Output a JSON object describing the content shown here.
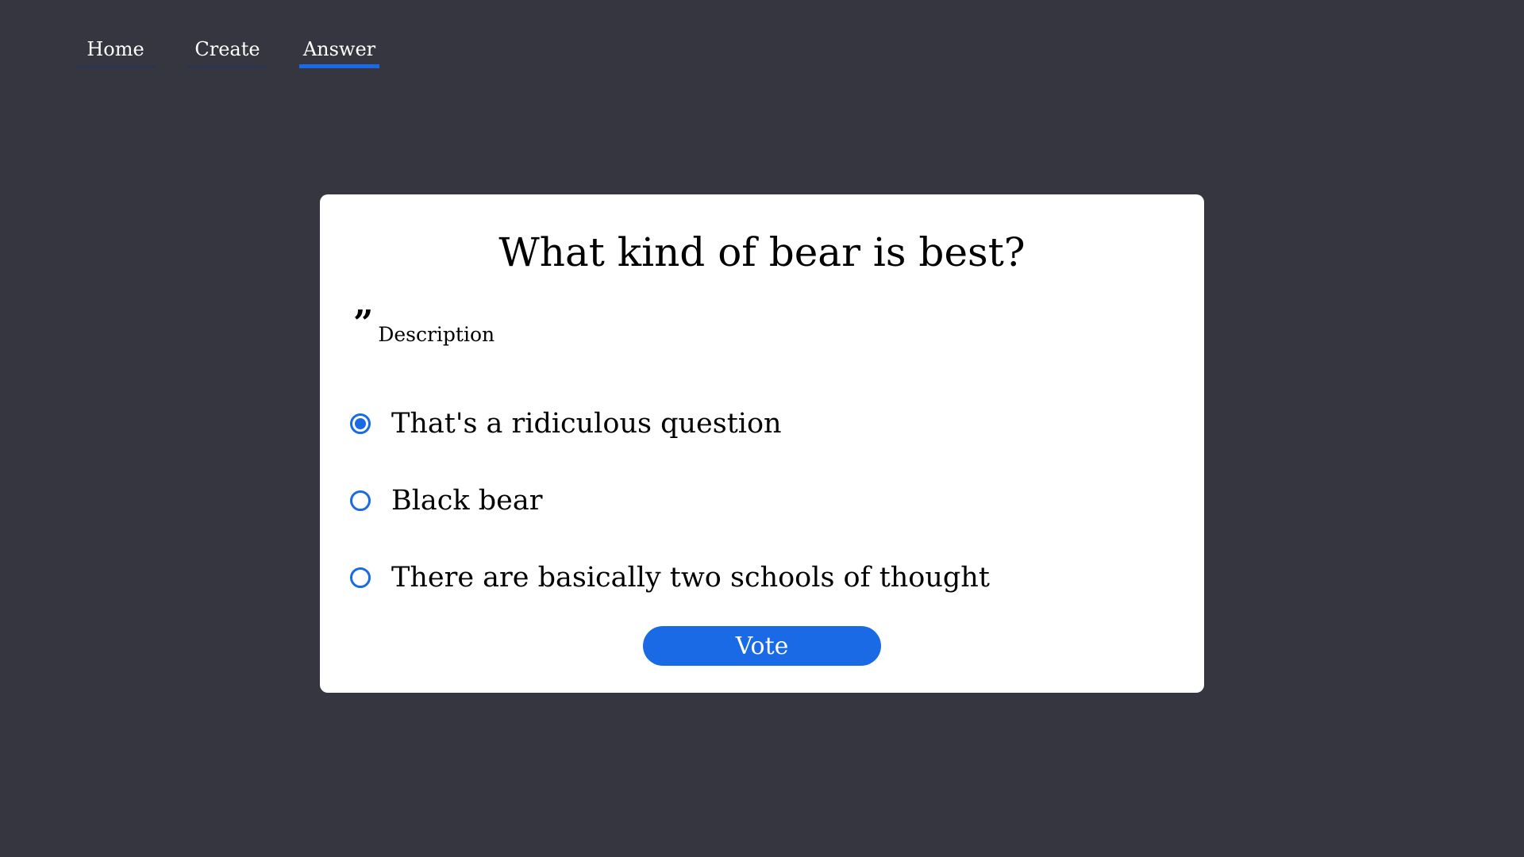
{
  "nav": {
    "tabs": [
      {
        "label": "Home",
        "active": false
      },
      {
        "label": "Create",
        "active": false
      },
      {
        "label": "Answer",
        "active": true
      }
    ]
  },
  "poll": {
    "question": "What kind of bear is best?",
    "description_icon": "quote-icon",
    "description": "Description",
    "options": [
      {
        "label": "That's a ridiculous question",
        "selected": true
      },
      {
        "label": "Black bear",
        "selected": false
      },
      {
        "label": "There are basically two schools of thought",
        "selected": false
      }
    ],
    "vote_label": "Vote"
  },
  "colors": {
    "background": "#363640",
    "accent": "#1a6ae6",
    "card": "#ffffff"
  }
}
